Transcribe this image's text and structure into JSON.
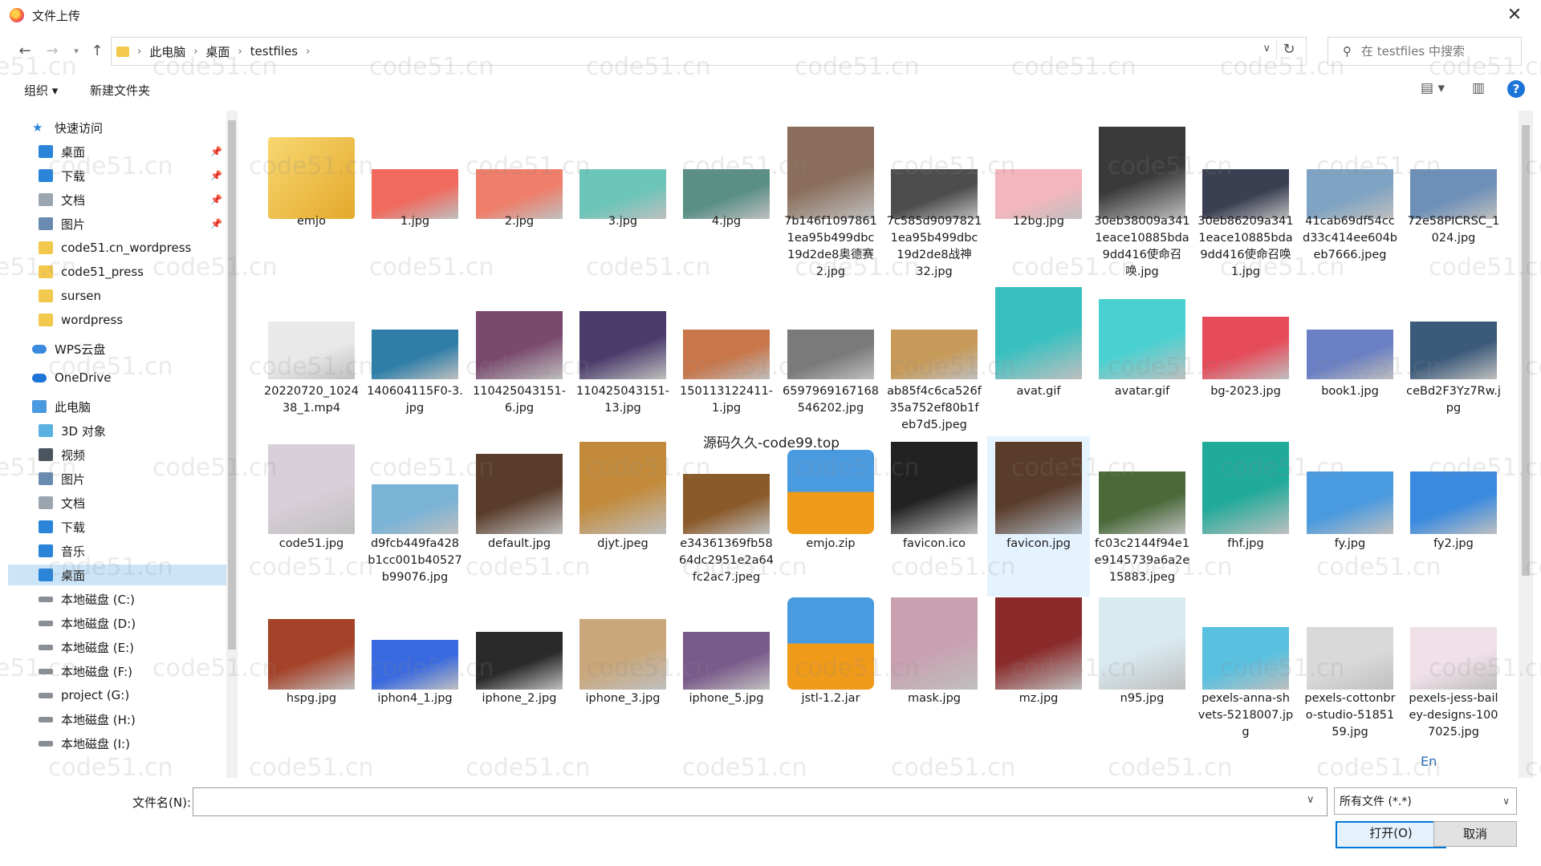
{
  "window": {
    "title": "文件上传",
    "close": "✕"
  },
  "address": {
    "crumbs": [
      "此电脑",
      "桌面",
      "testfiles"
    ],
    "search_placeholder": "在 testfiles 中搜索"
  },
  "toolbar": {
    "organize": "组织 ▾",
    "new_folder": "新建文件夹"
  },
  "sidebar": {
    "quick_access": "快速访问",
    "quick_items": [
      "桌面",
      "下载",
      "文档",
      "图片",
      "code51.cn_wordpress",
      "code51_press",
      "sursen",
      "wordpress"
    ],
    "wps": "WPS云盘",
    "onedrive": "OneDrive",
    "this_pc": "此电脑",
    "pc_items": [
      "3D 对象",
      "视频",
      "图片",
      "文档",
      "下载",
      "音乐",
      "桌面"
    ],
    "drives": [
      "本地磁盘 (C:)",
      "本地磁盘 (D:)",
      "本地磁盘 (E:)",
      "本地磁盘 (F:)",
      "project (G:)",
      "本地磁盘 (H:)",
      "本地磁盘 (I:)"
    ]
  },
  "files": [
    "emjo",
    "1.jpg",
    "2.jpg",
    "3.jpg",
    "4.jpg",
    "7b146f10978611ea95b499dbc19d2de8奥德赛2.jpg",
    "7c585d90978211ea95b499dbc19d2de8战神32.jpg",
    "12bg.jpg",
    "30eb38009a3411eace10885bda9dd416使命召唤.jpg",
    "30eb86209a3411eace10885bda9dd416使命召唤1.jpg",
    "41cab69df54ccd33c414ee604beb7666.jpeg",
    "72e58PICRSC_1024.jpg",
    "20220720_102438_1.mp4",
    "140604115F0-3.jpg",
    "110425043151-6.jpg",
    "110425043151-13.jpg",
    "150113122411-1.jpg",
    "6597969167168546202.jpg",
    "ab85f4c6ca526f35a752ef80b1feb7d5.jpeg",
    "avat.gif",
    "avatar.gif",
    "bg-2023.jpg",
    "book1.jpg",
    "ceBd2F3Yz7Rw.jpg",
    "code51.jpg",
    "d9fcb449fa428b1cc001b40527b99076.jpg",
    "default.jpg",
    "djyt.jpeg",
    "e34361369fb5864dc2951e2a64fc2ac7.jpeg",
    "emjo.zip",
    "favicon.ico",
    "favicon.jpg",
    "fc03c2144f94e1e9145739a6a2e15883.jpeg",
    "fhf.jpg",
    "fy.jpg",
    "fy2.jpg",
    "hspg.jpg",
    "iphon4_1.jpg",
    "iphone_2.jpg",
    "iphone_3.jpg",
    "iphone_5.jpg",
    "jstl-1.2.jar",
    "mask.jpg",
    "mz.jpg",
    "n95.jpg",
    "pexels-anna-shvets-5218007.jpg",
    "pexels-cottonbro-studio-5185159.jpg",
    "pexels-jess-bailey-designs-1007025.jpg"
  ],
  "labels": [
    [
      "emjo"
    ],
    [
      "1.jpg"
    ],
    [
      "2.jpg"
    ],
    [
      "3.jpg"
    ],
    [
      "4.jpg"
    ],
    [
      "7b146f1097861",
      "1ea95b499dbc",
      "19d2de8奥德赛",
      "2.jpg"
    ],
    [
      "7c585d9097821",
      "1ea95b499dbc",
      "19d2de8战神",
      "32.jpg"
    ],
    [
      "12bg.jpg"
    ],
    [
      "30eb38009a341",
      "1eace10885bda",
      "9dd416使命召",
      "唤.jpg"
    ],
    [
      "30eb86209a341",
      "1eace10885bda",
      "9dd416使命召唤",
      "1.jpg"
    ],
    [
      "41cab69df54cc",
      "d33c414ee604b",
      "eb7666.jpeg"
    ],
    [
      "72e58PICRSC_1",
      "024.jpg"
    ],
    [
      "20220720_1024",
      "38_1.mp4"
    ],
    [
      "140604115F0-3.",
      "jpg"
    ],
    [
      "110425043151-",
      "6.jpg"
    ],
    [
      "110425043151-",
      "13.jpg"
    ],
    [
      "150113122411-",
      "1.jpg"
    ],
    [
      "6597969167168",
      "546202.jpg"
    ],
    [
      "ab85f4c6ca526f",
      "35a752ef80b1f",
      "eb7d5.jpeg"
    ],
    [
      "avat.gif"
    ],
    [
      "avatar.gif"
    ],
    [
      "bg-2023.jpg"
    ],
    [
      "book1.jpg"
    ],
    [
      "ceBd2F3Yz7Rw.j",
      "pg"
    ],
    [
      "code51.jpg"
    ],
    [
      "d9fcb449fa428",
      "b1cc001b40527",
      "b99076.jpg"
    ],
    [
      "default.jpg"
    ],
    [
      "djyt.jpeg"
    ],
    [
      "e34361369fb58",
      "64dc2951e2a64",
      "fc2ac7.jpeg"
    ],
    [
      "emjo.zip"
    ],
    [
      "favicon.ico"
    ],
    [
      "favicon.jpg"
    ],
    [
      "fc03c2144f94e1",
      "e9145739a6a2e",
      "15883.jpeg"
    ],
    [
      "fhf.jpg"
    ],
    [
      "fy.jpg"
    ],
    [
      "fy2.jpg"
    ],
    [
      "hspg.jpg"
    ],
    [
      "iphon4_1.jpg"
    ],
    [
      "iphone_2.jpg"
    ],
    [
      "iphone_3.jpg"
    ],
    [
      "iphone_5.jpg"
    ],
    [
      "jstl-1.2.jar"
    ],
    [
      "mask.jpg"
    ],
    [
      "mz.jpg"
    ],
    [
      "n95.jpg"
    ],
    [
      "pexels-anna-sh",
      "vets-5218007.jp",
      "g"
    ],
    [
      "pexels-cottonbr",
      "o-studio-51851",
      "59.jpg"
    ],
    [
      "pexels-jess-bail",
      "ey-designs-100",
      "7025.jpg"
    ]
  ],
  "colors": [
    "#f0c24a",
    "#f06a5e",
    "#ef7e6a",
    "#6bc5b8",
    "#5a8f86",
    "#8a6d5a",
    "#4d4d4d",
    "#f4b6be",
    "#3a3a3a",
    "#3a3f52",
    "#7fa3c2",
    "#6d8fb8",
    "#e9e9e9",
    "#2f7ea8",
    "#7a4a6e",
    "#4a3b6b",
    "#c9764a",
    "#7a7a7a",
    "#c79a5a",
    "#38c0c0",
    "#49d1d1",
    "#e64b5a",
    "#6a7fc4",
    "#3c5a7a",
    "#d8cfd8",
    "#7bb3d6",
    "#5a3c2a",
    "#c28a3a",
    "#8a5a2a",
    "#f09a1a",
    "#222222",
    "#5a3c2a",
    "#4a6a3a",
    "#1faa9a",
    "#4a9ae0",
    "#3a8ae0",
    "#a5432a",
    "#3a6ae0",
    "#2a2a2a",
    "#c9a77a",
    "#7a5a8a",
    "#f09a1a",
    "#c9a0b0",
    "#8a2a2a",
    "#d9eaf0",
    "#5ac0e0",
    "#d9d9d9",
    "#f0e0e8"
  ],
  "overlay": "源码久久-code99.top",
  "watermark": "code51.cn",
  "bottom": {
    "filename_label": "文件名(N):",
    "filename_value": "",
    "filter": "所有文件 (*.*)",
    "open": "打开(O)",
    "cancel": "取消"
  },
  "ime": "En"
}
